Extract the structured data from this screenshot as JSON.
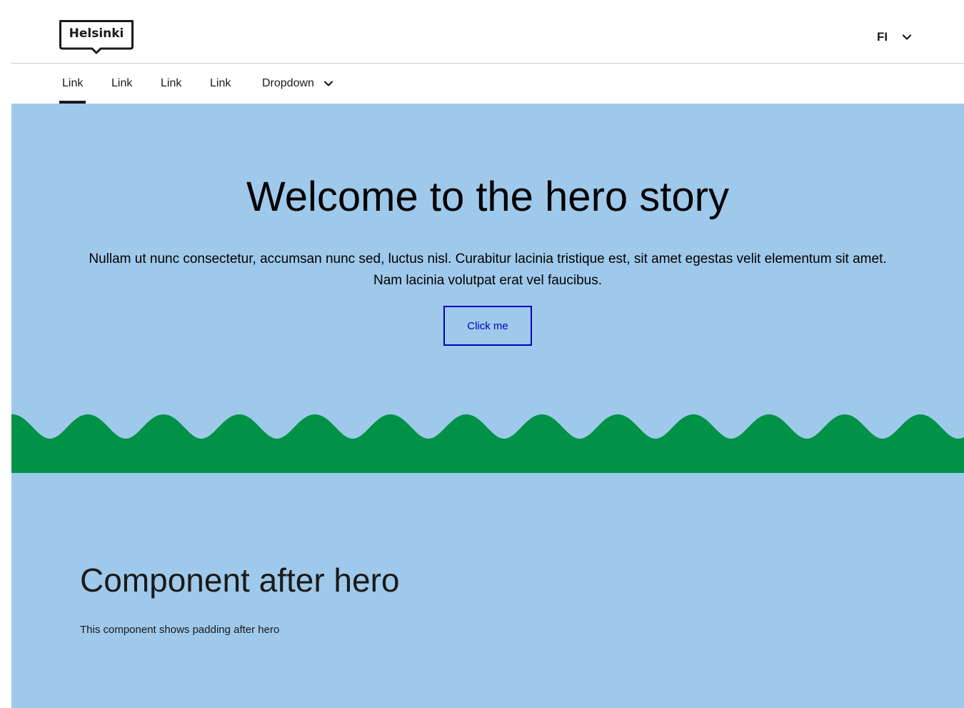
{
  "header": {
    "logo_text": "Helsinki",
    "language": "FI"
  },
  "nav": {
    "items": [
      {
        "label": "Link",
        "active": true
      },
      {
        "label": "Link",
        "active": false
      },
      {
        "label": "Link",
        "active": false
      },
      {
        "label": "Link",
        "active": false
      }
    ],
    "dropdown_label": "Dropdown"
  },
  "hero": {
    "title": "Welcome to the hero story",
    "text": "Nullam ut nunc consectetur, accumsan nunc sed, luctus nisl. Curabitur lacinia tristique est, sit amet egestas velit elementum sit amet. Nam lacinia volutpat erat vel faucibus.",
    "button_label": "Click me"
  },
  "after_hero": {
    "title": "Component after hero",
    "text": "This component shows padding after hero"
  },
  "icons": {
    "language_chevron": "chevron-down-icon",
    "dropdown_chevron": "chevron-down-icon"
  },
  "colors": {
    "hero_background": "#9fc9eb",
    "wave_green": "#009246",
    "button_blue": "#0000bf",
    "text_dark": "#1a1a1a",
    "divider": "#cccccc"
  }
}
